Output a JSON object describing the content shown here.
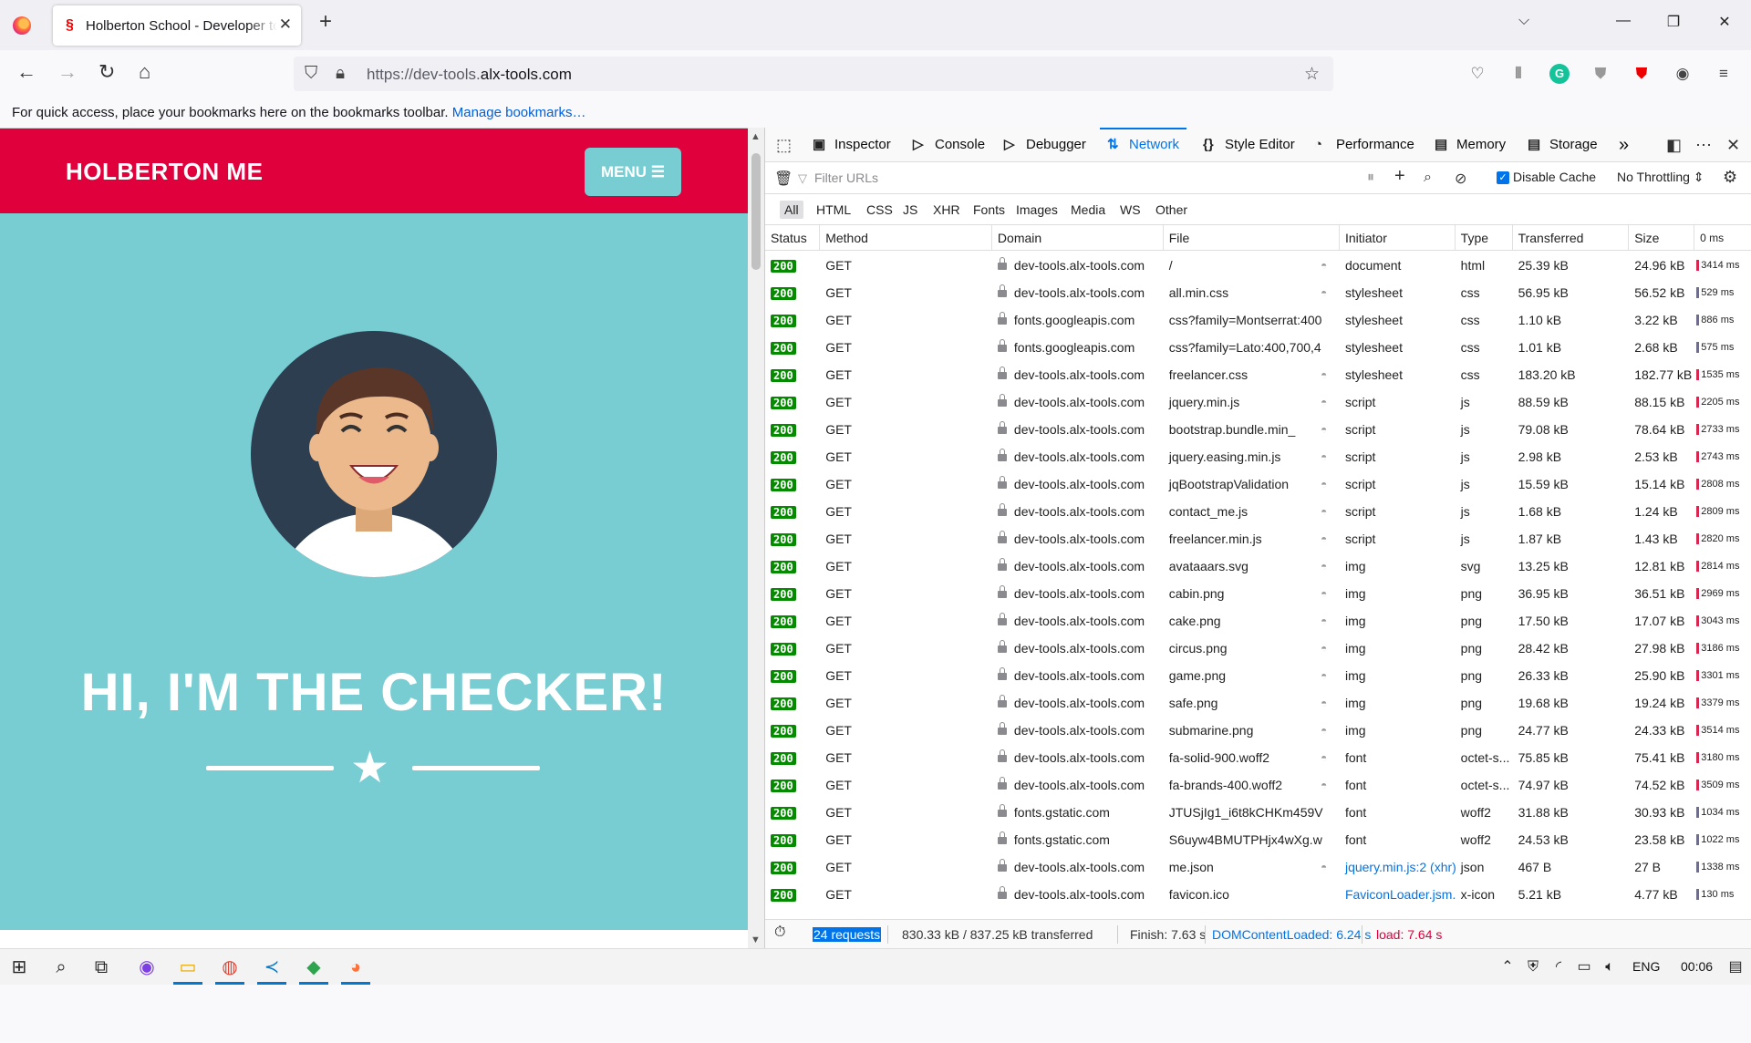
{
  "browser": {
    "tab_title": "Holberton School - Developer tools",
    "tab_close": "✕",
    "new_tab": "+",
    "url_scheme": "https://dev-tools.",
    "url_host": "alx-tools.com",
    "bookmarks_hint": "For quick access, place your bookmarks here on the bookmarks toolbar.",
    "bookmarks_link": "Manage bookmarks…"
  },
  "page": {
    "brand": "HOLBERTON ME",
    "menu_label": "MENU ☰",
    "hero_title": "HI, I'M THE CHECKER!",
    "star": "★"
  },
  "devtools": {
    "tabs": [
      {
        "label": "Inspector",
        "icon": "▣"
      },
      {
        "label": "Console",
        "icon": "▷"
      },
      {
        "label": "Debugger",
        "icon": "▷"
      },
      {
        "label": "Network",
        "icon": "⇅"
      },
      {
        "label": "Style Editor",
        "icon": "{}"
      },
      {
        "label": "Performance",
        "icon": "◔"
      },
      {
        "label": "Memory",
        "icon": "▤"
      },
      {
        "label": "Storage",
        "icon": "▤"
      }
    ],
    "more_tabs": "»",
    "filter_placeholder": "Filter URLs",
    "disable_cache_label": "Disable Cache",
    "throttling_label": "No Throttling ⇕",
    "type_filters": [
      "All",
      "HTML",
      "CSS",
      "JS",
      "XHR",
      "Fonts",
      "Images",
      "Media",
      "WS",
      "Other"
    ],
    "columns": [
      "Status",
      "Method",
      "Domain",
      "File",
      "Initiator",
      "Type",
      "Transferred",
      "Size",
      "0 ms"
    ],
    "requests": [
      {
        "status": "200",
        "method": "GET",
        "domain": "dev-tools.alx-tools.com",
        "file": "/",
        "initiator": "document",
        "type": "html",
        "transferred": "25.39 kB",
        "size": "24.96 kB",
        "time": "3414 ms",
        "tracker": true
      },
      {
        "status": "200",
        "method": "GET",
        "domain": "dev-tools.alx-tools.com",
        "file": "all.min.css",
        "initiator": "stylesheet",
        "type": "css",
        "transferred": "56.95 kB",
        "size": "56.52 kB",
        "time": "529 ms",
        "tracker": true
      },
      {
        "status": "200",
        "method": "GET",
        "domain": "fonts.googleapis.com",
        "file": "css?family=Montserrat:400",
        "initiator": "stylesheet",
        "type": "css",
        "transferred": "1.10 kB",
        "size": "3.22 kB",
        "time": "886 ms",
        "tracker": false
      },
      {
        "status": "200",
        "method": "GET",
        "domain": "fonts.googleapis.com",
        "file": "css?family=Lato:400,700,4",
        "initiator": "stylesheet",
        "type": "css",
        "transferred": "1.01 kB",
        "size": "2.68 kB",
        "time": "575 ms",
        "tracker": false
      },
      {
        "status": "200",
        "method": "GET",
        "domain": "dev-tools.alx-tools.com",
        "file": "freelancer.css",
        "initiator": "stylesheet",
        "type": "css",
        "transferred": "183.20 kB",
        "size": "182.77 kB",
        "time": "1535 ms",
        "tracker": true
      },
      {
        "status": "200",
        "method": "GET",
        "domain": "dev-tools.alx-tools.com",
        "file": "jquery.min.js",
        "initiator": "script",
        "type": "js",
        "transferred": "88.59 kB",
        "size": "88.15 kB",
        "time": "2205 ms",
        "tracker": true
      },
      {
        "status": "200",
        "method": "GET",
        "domain": "dev-tools.alx-tools.com",
        "file": "bootstrap.bundle.min_",
        "initiator": "script",
        "type": "js",
        "transferred": "79.08 kB",
        "size": "78.64 kB",
        "time": "2733 ms",
        "tracker": true
      },
      {
        "status": "200",
        "method": "GET",
        "domain": "dev-tools.alx-tools.com",
        "file": "jquery.easing.min.js",
        "initiator": "script",
        "type": "js",
        "transferred": "2.98 kB",
        "size": "2.53 kB",
        "time": "2743 ms",
        "tracker": true
      },
      {
        "status": "200",
        "method": "GET",
        "domain": "dev-tools.alx-tools.com",
        "file": "jqBootstrapValidation",
        "initiator": "script",
        "type": "js",
        "transferred": "15.59 kB",
        "size": "15.14 kB",
        "time": "2808 ms",
        "tracker": true
      },
      {
        "status": "200",
        "method": "GET",
        "domain": "dev-tools.alx-tools.com",
        "file": "contact_me.js",
        "initiator": "script",
        "type": "js",
        "transferred": "1.68 kB",
        "size": "1.24 kB",
        "time": "2809 ms",
        "tracker": true
      },
      {
        "status": "200",
        "method": "GET",
        "domain": "dev-tools.alx-tools.com",
        "file": "freelancer.min.js",
        "initiator": "script",
        "type": "js",
        "transferred": "1.87 kB",
        "size": "1.43 kB",
        "time": "2820 ms",
        "tracker": true
      },
      {
        "status": "200",
        "method": "GET",
        "domain": "dev-tools.alx-tools.com",
        "file": "avataaars.svg",
        "initiator": "img",
        "type": "svg",
        "transferred": "13.25 kB",
        "size": "12.81 kB",
        "time": "2814 ms",
        "tracker": true
      },
      {
        "status": "200",
        "method": "GET",
        "domain": "dev-tools.alx-tools.com",
        "file": "cabin.png",
        "initiator": "img",
        "type": "png",
        "transferred": "36.95 kB",
        "size": "36.51 kB",
        "time": "2969 ms",
        "tracker": true
      },
      {
        "status": "200",
        "method": "GET",
        "domain": "dev-tools.alx-tools.com",
        "file": "cake.png",
        "initiator": "img",
        "type": "png",
        "transferred": "17.50 kB",
        "size": "17.07 kB",
        "time": "3043 ms",
        "tracker": true
      },
      {
        "status": "200",
        "method": "GET",
        "domain": "dev-tools.alx-tools.com",
        "file": "circus.png",
        "initiator": "img",
        "type": "png",
        "transferred": "28.42 kB",
        "size": "27.98 kB",
        "time": "3186 ms",
        "tracker": true
      },
      {
        "status": "200",
        "method": "GET",
        "domain": "dev-tools.alx-tools.com",
        "file": "game.png",
        "initiator": "img",
        "type": "png",
        "transferred": "26.33 kB",
        "size": "25.90 kB",
        "time": "3301 ms",
        "tracker": true
      },
      {
        "status": "200",
        "method": "GET",
        "domain": "dev-tools.alx-tools.com",
        "file": "safe.png",
        "initiator": "img",
        "type": "png",
        "transferred": "19.68 kB",
        "size": "19.24 kB",
        "time": "3379 ms",
        "tracker": true
      },
      {
        "status": "200",
        "method": "GET",
        "domain": "dev-tools.alx-tools.com",
        "file": "submarine.png",
        "initiator": "img",
        "type": "png",
        "transferred": "24.77 kB",
        "size": "24.33 kB",
        "time": "3514 ms",
        "tracker": true
      },
      {
        "status": "200",
        "method": "GET",
        "domain": "dev-tools.alx-tools.com",
        "file": "fa-solid-900.woff2",
        "initiator": "font",
        "type": "octet-s...",
        "transferred": "75.85 kB",
        "size": "75.41 kB",
        "time": "3180 ms",
        "tracker": true
      },
      {
        "status": "200",
        "method": "GET",
        "domain": "dev-tools.alx-tools.com",
        "file": "fa-brands-400.woff2",
        "initiator": "font",
        "type": "octet-s...",
        "transferred": "74.97 kB",
        "size": "74.52 kB",
        "time": "3509 ms",
        "tracker": true
      },
      {
        "status": "200",
        "method": "GET",
        "domain": "fonts.gstatic.com",
        "file": "JTUSjIg1_i6t8kCHKm459V",
        "initiator": "font",
        "type": "woff2",
        "transferred": "31.88 kB",
        "size": "30.93 kB",
        "time": "1034 ms",
        "tracker": false
      },
      {
        "status": "200",
        "method": "GET",
        "domain": "fonts.gstatic.com",
        "file": "S6uyw4BMUTPHjx4wXg.w",
        "initiator": "font",
        "type": "woff2",
        "transferred": "24.53 kB",
        "size": "23.58 kB",
        "time": "1022 ms",
        "tracker": false
      },
      {
        "status": "200",
        "method": "GET",
        "domain": "dev-tools.alx-tools.com",
        "file": "me.json",
        "initiator": "jquery.min.js:2 (xhr)",
        "type": "json",
        "transferred": "467 B",
        "size": "27 B",
        "time": "1338 ms",
        "tracker": true,
        "initiator_link": true
      },
      {
        "status": "200",
        "method": "GET",
        "domain": "dev-tools.alx-tools.com",
        "file": "favicon.ico",
        "initiator": "FaviconLoader.jsm...",
        "type": "x-icon",
        "transferred": "5.21 kB",
        "size": "4.77 kB",
        "time": "130 ms",
        "tracker": false,
        "initiator_link": true
      }
    ],
    "summary": {
      "requests": "24 requests",
      "transferred": "830.33 kB / 837.25 kB transferred",
      "finish": "Finish: 7.63 s",
      "dcl": "DOMContentLoaded: 6.24 s",
      "load": "load: 7.64 s"
    },
    "colors": {
      "accent": "#0074e8",
      "status_ok": "#058b00",
      "dcl": "#0074e8",
      "load": "#e0003c"
    }
  },
  "taskbar": {
    "lang": "ENG",
    "time": "00:06"
  }
}
